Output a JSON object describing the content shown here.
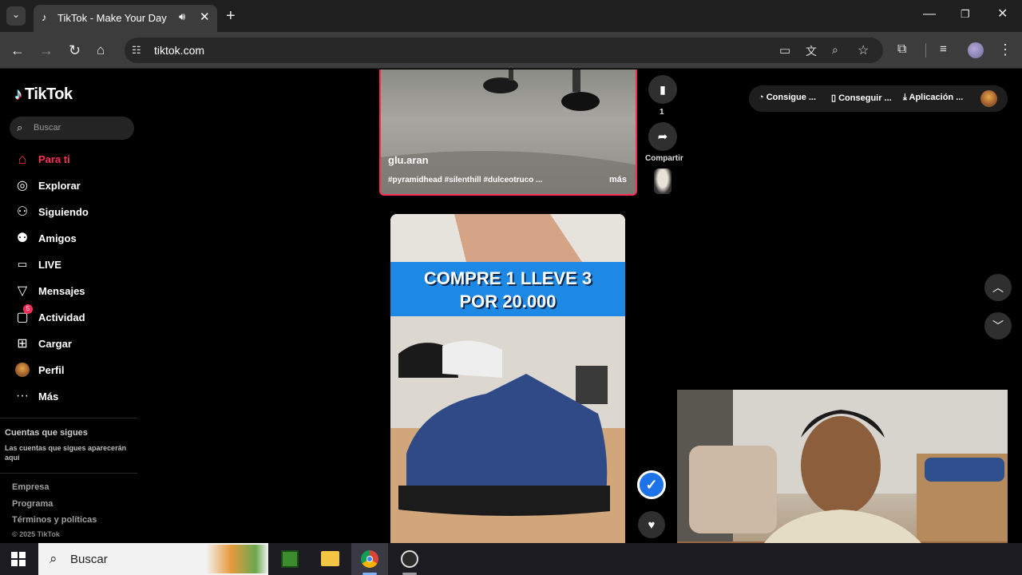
{
  "browser": {
    "tab_title": "TikTok - Make Your Day",
    "url": "tiktok.com"
  },
  "tiktok": {
    "logo": "TikTok",
    "search_placeholder": "Buscar",
    "nav": [
      {
        "label": "Para ti",
        "icon": "home-icon",
        "active": true
      },
      {
        "label": "Explorar",
        "icon": "compass-icon"
      },
      {
        "label": "Siguiendo",
        "icon": "following-icon"
      },
      {
        "label": "Amigos",
        "icon": "friends-icon"
      },
      {
        "label": "LIVE",
        "icon": "live-icon"
      },
      {
        "label": "Mensajes",
        "icon": "messages-icon"
      },
      {
        "label": "Actividad",
        "icon": "activity-icon",
        "badge": "5"
      },
      {
        "label": "Cargar",
        "icon": "upload-icon"
      },
      {
        "label": "Perfil",
        "icon": "profile-avatar-icon"
      },
      {
        "label": "Más",
        "icon": "more-icon"
      }
    ],
    "following": {
      "title": "Cuentas que sigues",
      "subtitle": "Las cuentas que sigues aparecerán aquí"
    },
    "footer": [
      "Empresa",
      "Programa",
      "Términos y políticas",
      "© 2025 TikTok"
    ]
  },
  "video1": {
    "author": "glu.aran",
    "caption": "#pyramidhead #silenthill #dulceotruco ...",
    "more": "más",
    "save_count": "1",
    "share_label": "Compartir"
  },
  "video2": {
    "banner_line1": "COMPRE 1 LLEVE 3",
    "banner_line2": "POR 20.000"
  },
  "top_actions": [
    "Consigue ...",
    "Conseguir ...",
    "Aplicación ..."
  ],
  "taskbar": {
    "search_label": "Buscar"
  },
  "colors": {
    "accent": "#fe2c55",
    "banner": "#1e88e5"
  }
}
